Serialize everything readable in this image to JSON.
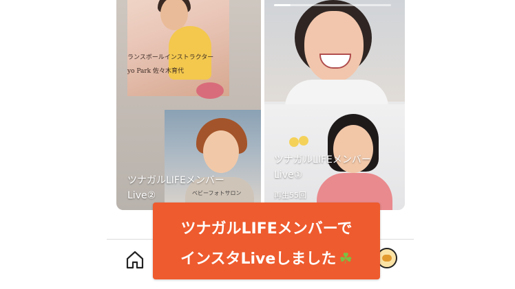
{
  "tiles": {
    "left": {
      "title_line1": "ツナガルLIFEメンバー",
      "title_line2": "Live②",
      "photo_caption_line1": "ランスボールインストラクター",
      "photo_caption_line2": "yo Park 佐々木育代",
      "photo_note": "ベビーフォトサロン"
    },
    "right": {
      "title_line1": "ツナガルLIFEメンバー",
      "title_line2": "Live①",
      "views": "再生55回",
      "progress": 0.14
    }
  },
  "banner": {
    "line1": "ツナガルLIFEメンバーで",
    "line2": "インスタLiveしました",
    "emoji": "☘"
  },
  "icons": {
    "home": "home-icon",
    "profile": "profile-avatar-icon"
  },
  "colors": {
    "banner_bg": "#ee5b2e",
    "clover": "#7bc043"
  }
}
